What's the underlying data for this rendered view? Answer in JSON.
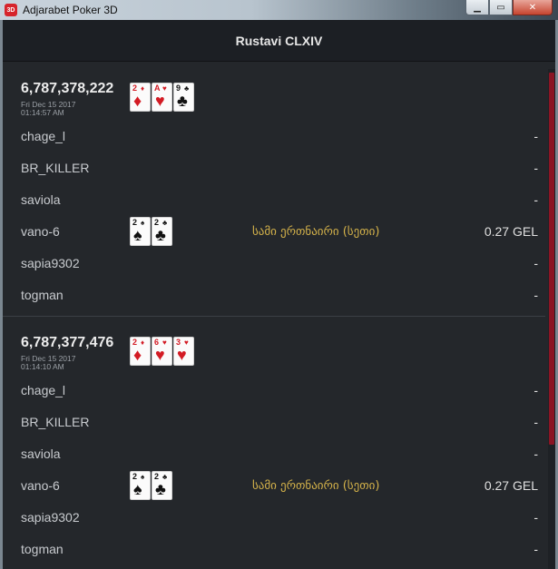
{
  "window": {
    "title": "Adjarabet Poker 3D",
    "icon_text": "3D",
    "controls": {
      "minimize": "▁",
      "maximize": "▭",
      "close": "✕"
    }
  },
  "header": {
    "title": "Rustavi CLXIV"
  },
  "colors": {
    "accent": "#8b1524",
    "rank_text": "#d4b24a",
    "card_red": "#d31b24"
  },
  "hands": [
    {
      "id": "6,787,378,222",
      "date": "Fri Dec 15 2017",
      "time": "01:14:57 AM",
      "board": [
        {
          "rank": "2",
          "suit": "♦",
          "color": "red"
        },
        {
          "rank": "A",
          "suit": "♥",
          "color": "red"
        },
        {
          "rank": "9",
          "suit": "♣",
          "color": "black"
        }
      ],
      "players": [
        {
          "name": "chage_l",
          "result": "-"
        },
        {
          "name": "BR_KILLER",
          "result": "-"
        },
        {
          "name": "saviola",
          "result": "-"
        },
        {
          "name": "vano-6",
          "result": "0.27 GEL",
          "hand_rank": "სამი ერთნაირი (სეთი)",
          "hole": [
            {
              "rank": "2",
              "suit": "♠",
              "color": "black"
            },
            {
              "rank": "2",
              "suit": "♣",
              "color": "black"
            }
          ]
        },
        {
          "name": "sapia9302",
          "result": "-"
        },
        {
          "name": "togman",
          "result": "-"
        }
      ]
    },
    {
      "id": "6,787,377,476",
      "date": "Fri Dec 15 2017",
      "time": "01:14:10 AM",
      "board": [
        {
          "rank": "2",
          "suit": "♦",
          "color": "red"
        },
        {
          "rank": "6",
          "suit": "♥",
          "color": "red"
        },
        {
          "rank": "3",
          "suit": "♥",
          "color": "red"
        }
      ],
      "players": [
        {
          "name": "chage_l",
          "result": "-"
        },
        {
          "name": "BR_KILLER",
          "result": "-"
        },
        {
          "name": "saviola",
          "result": "-"
        },
        {
          "name": "vano-6",
          "result": "0.27 GEL",
          "hand_rank": "სამი ერთნაირი (სეთი)",
          "hole": [
            {
              "rank": "2",
              "suit": "♠",
              "color": "black"
            },
            {
              "rank": "2",
              "suit": "♣",
              "color": "black"
            }
          ]
        },
        {
          "name": "sapia9302",
          "result": "-"
        },
        {
          "name": "togman",
          "result": "-"
        }
      ]
    }
  ]
}
